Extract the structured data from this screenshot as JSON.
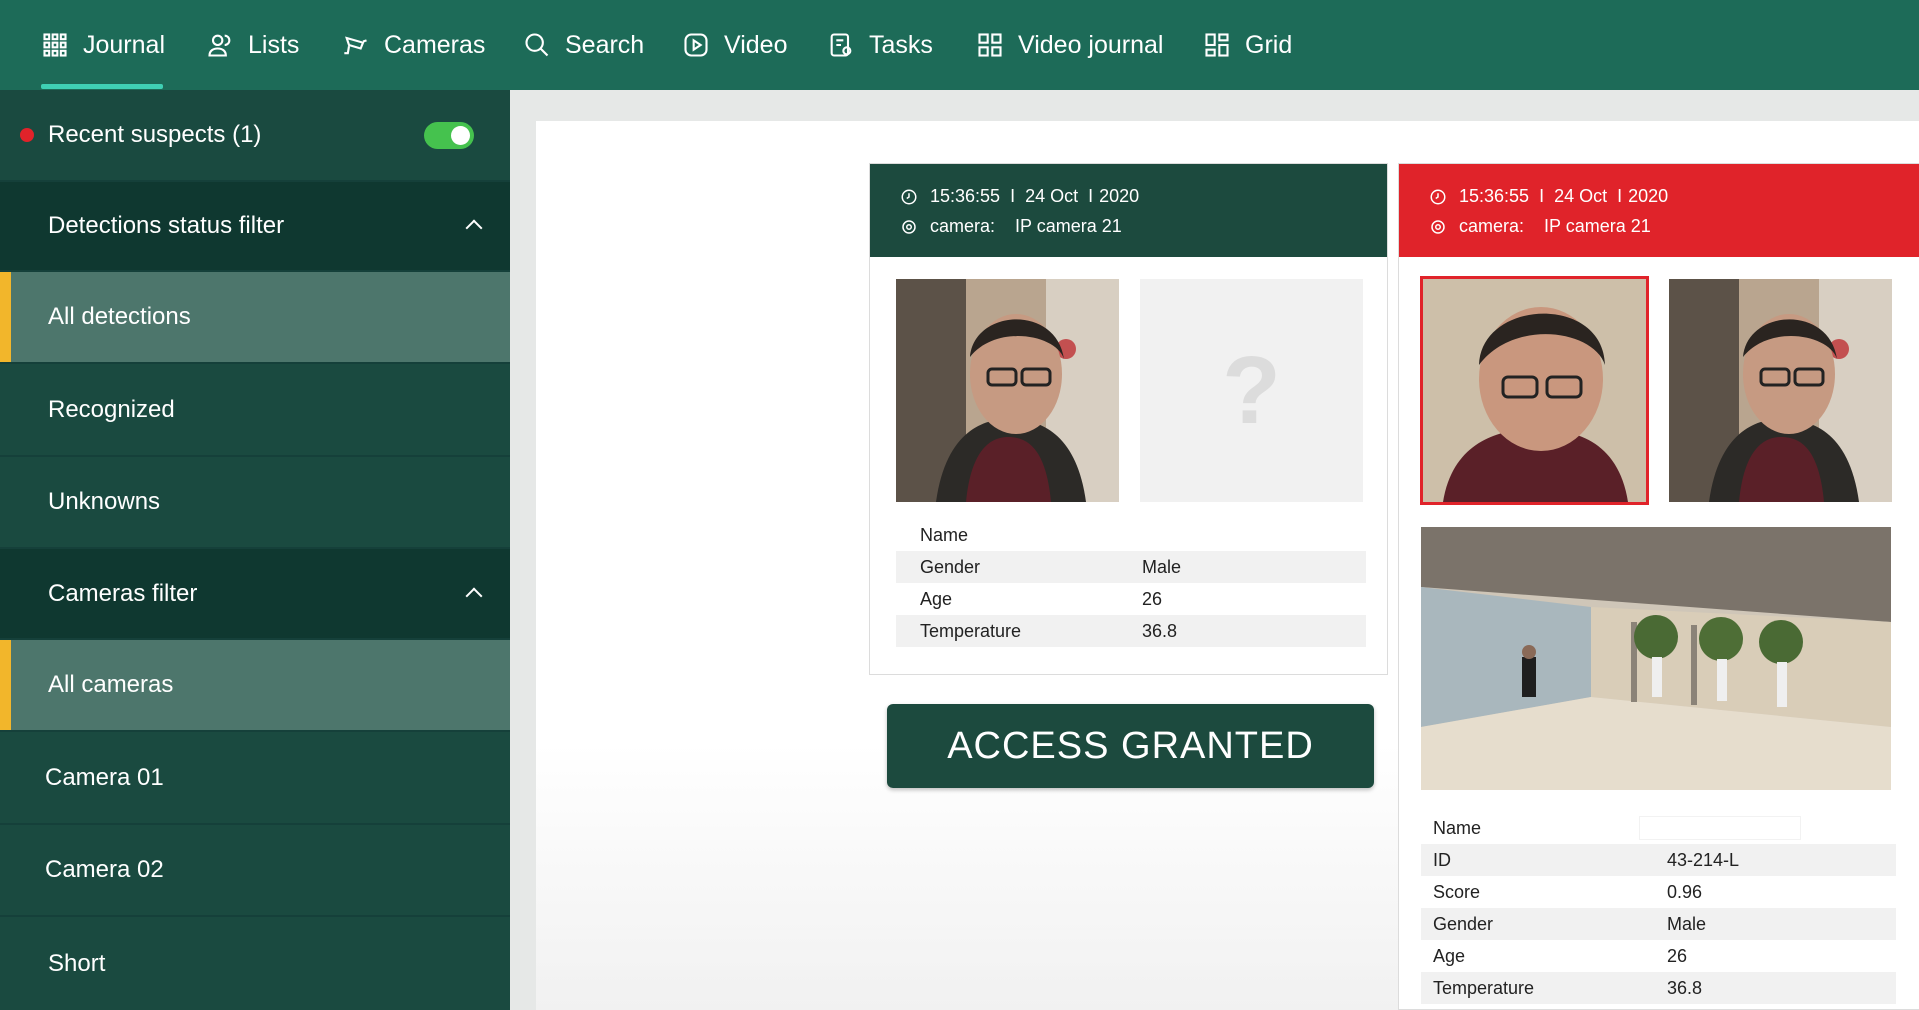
{
  "nav": {
    "items": [
      {
        "label": "Journal",
        "icon": "grid-dots-icon"
      },
      {
        "label": "Lists",
        "icon": "users-icon"
      },
      {
        "label": "Cameras",
        "icon": "camera-icon"
      },
      {
        "label": "Search",
        "icon": "search-icon"
      },
      {
        "label": "Video",
        "icon": "play-icon"
      },
      {
        "label": "Tasks",
        "icon": "tasks-icon"
      },
      {
        "label": "Video journal",
        "icon": "four-squares-icon"
      },
      {
        "label": "Grid",
        "icon": "layout-icon"
      }
    ],
    "active": "Journal"
  },
  "sidebar": {
    "recent_suspects": "Recent suspects (1)",
    "recent_toggle_on": true,
    "detections_filter_title": "Detections status filter",
    "detections": [
      "All detections",
      "Recognized",
      "Unknowns"
    ],
    "cameras_filter_title": "Cameras filter",
    "cameras": [
      "All cameras",
      "Camera 01",
      "Camera 02",
      "Short"
    ]
  },
  "card_left": {
    "time": "15:36:55",
    "date": "24 Oct",
    "year": "2020",
    "camera_label": "camera:",
    "camera_value": "IP camera 21",
    "unknown_mark": "?",
    "attributes": [
      {
        "key": "Name",
        "value": ""
      },
      {
        "key": "Gender",
        "value": "Male"
      },
      {
        "key": "Age",
        "value": "26"
      },
      {
        "key": "Temperature",
        "value": "36.8"
      }
    ]
  },
  "card_right": {
    "time": "15:36:55",
    "date": "24 Oct",
    "year": "2020",
    "camera_label": "camera:",
    "camera_value": "IP camera 21",
    "attributes": [
      {
        "key": "Name",
        "value": ""
      },
      {
        "key": "ID",
        "value": "43-214-L"
      },
      {
        "key": "Score",
        "value": "0.96"
      },
      {
        "key": "Gender",
        "value": "Male"
      },
      {
        "key": "Age",
        "value": "26"
      },
      {
        "key": "Temperature",
        "value": "36.8"
      }
    ]
  },
  "access_status": "ACCESS GRANTED",
  "colors": {
    "nav": "#1d6b58",
    "sidebar": "#1a4a40",
    "selected": "#4d766c",
    "accent_yellow": "#f2b62b",
    "alert_red": "#e0232a",
    "card_head_dark": "#1c4a3e"
  }
}
